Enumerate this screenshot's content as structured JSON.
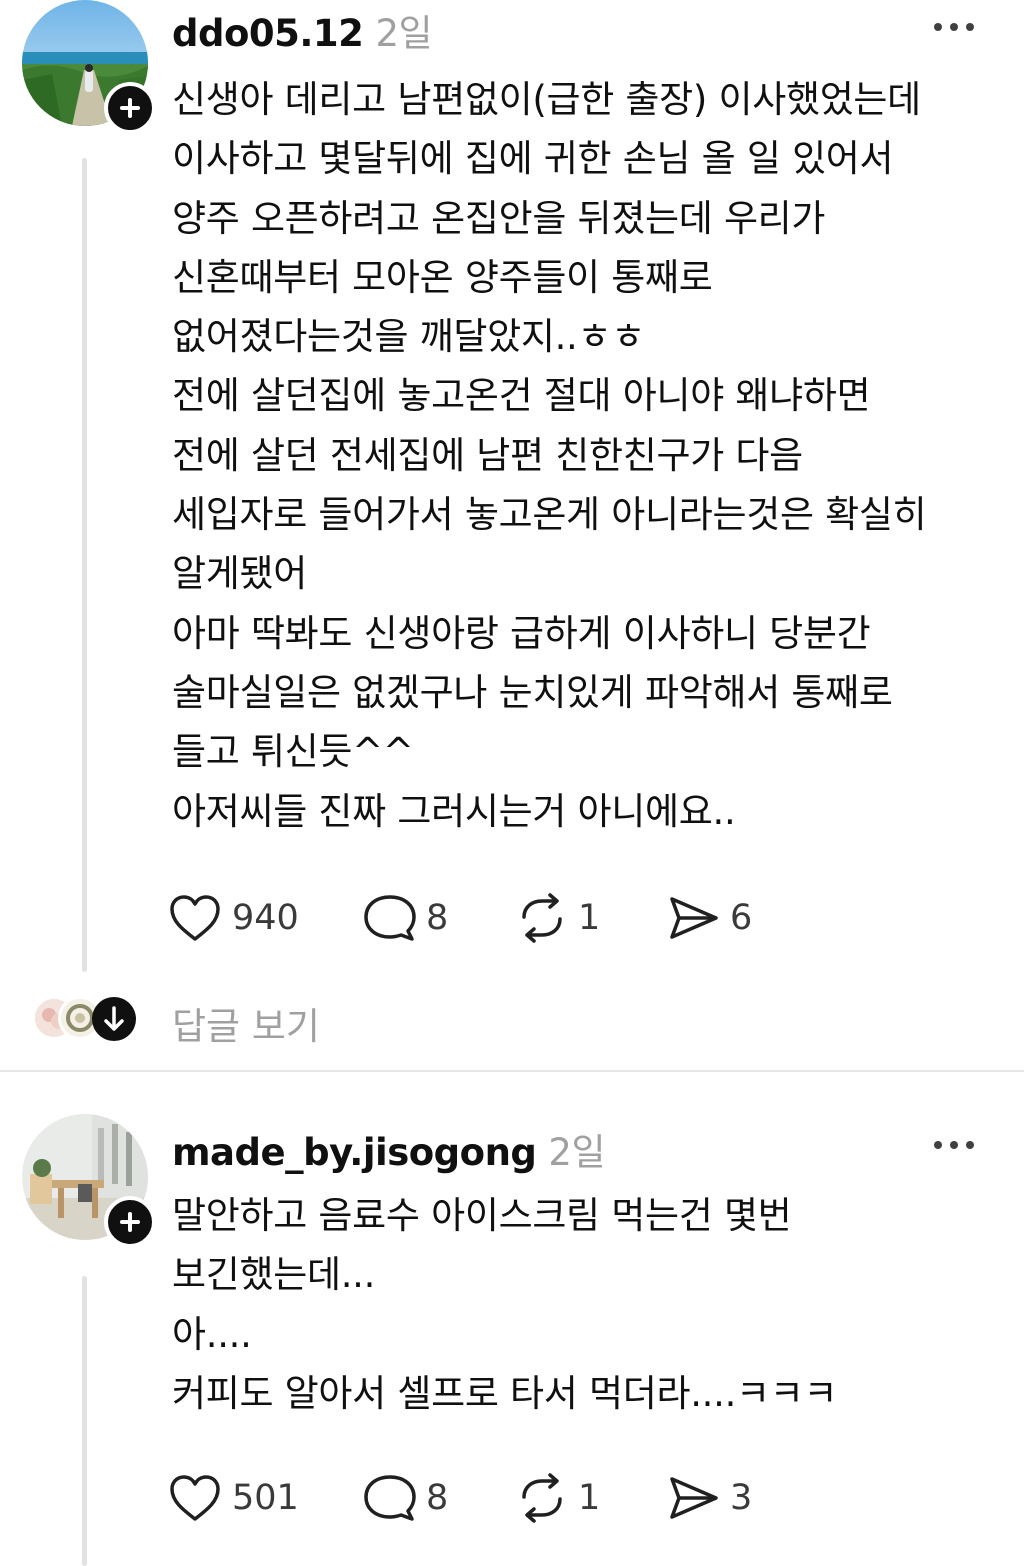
{
  "posts": [
    {
      "username": "ddo05.12",
      "time": "2일",
      "avatar_icon": "beach-photo-avatar",
      "body": "신생아 데리고 남편없이(급한 출장) 이사했었는데\n이사하고 몇달뒤에 집에 귀한 손님 올 일 있어서\n양주 오픈하려고 온집안을 뒤졌는데 우리가\n신혼때부터 모아온 양주들이 통째로\n없어졌다는것을 깨달았지..ㅎㅎ\n전에 살던집에 놓고온건 절대 아니야 왜냐하면\n전에 살던 전세집에 남편 친한친구가 다음\n세입자로 들어가서 놓고온게 아니라는것은 확실히\n알게됐어\n아마 딱봐도 신생아랑 급하게 이사하니 당분간\n술마실일은 없겠구나 눈치있게 파악해서 통째로\n들고 튀신듯^^\n아저씨들 진짜 그러시는거 아니에요..",
      "likes": "940",
      "comments": "8",
      "reposts": "1",
      "shares": "6"
    },
    {
      "username": "made_by.jisogong",
      "time": "2일",
      "avatar_icon": "interior-photo-avatar",
      "body": "말안하고 음료수 아이스크림 먹는건 몇번\n보긴했는데...\n아....\n커피도 알아서 셀프로 타서 먹더라....ㅋㅋㅋ",
      "likes": "501",
      "comments": "8",
      "reposts": "1",
      "shares": "3"
    }
  ],
  "view_replies_label": "답글 보기",
  "icons": {
    "like": "heart-icon",
    "comment": "comment-bubble-icon",
    "repost": "repost-arrows-icon",
    "share": "send-paper-plane-icon",
    "more": "more-dots-icon",
    "follow": "plus-icon",
    "expand": "arrow-down-icon"
  },
  "colors": {
    "text": "#101010",
    "muted": "#a0a0a0",
    "thread_line": "#e2e2e2",
    "divider": "#e6e6e6"
  }
}
